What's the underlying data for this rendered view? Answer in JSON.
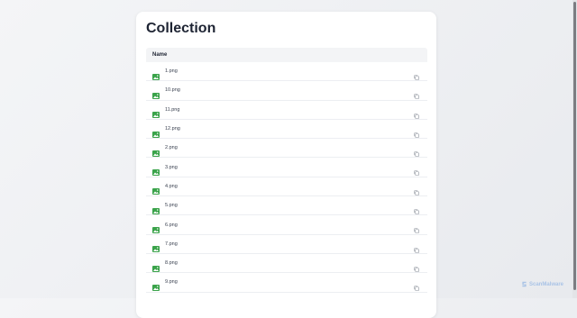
{
  "page": {
    "title": "Collection"
  },
  "table": {
    "header_name": "Name",
    "rows": [
      {
        "name": "1.png"
      },
      {
        "name": "10.png"
      },
      {
        "name": "11.png"
      },
      {
        "name": "12.png"
      },
      {
        "name": "2.png"
      },
      {
        "name": "3.png"
      },
      {
        "name": "4.png"
      },
      {
        "name": "5.png"
      },
      {
        "name": "6.png"
      },
      {
        "name": "7.png"
      },
      {
        "name": "8.png"
      },
      {
        "name": "9.png"
      }
    ]
  },
  "icons": {
    "file": "image-file-icon",
    "copy": "copy-icon"
  },
  "colors": {
    "file_icon": "#3aa34a",
    "title": "#1e2433",
    "header_bg": "#f3f4f6"
  },
  "watermark": {
    "text": "ScanMalware"
  }
}
